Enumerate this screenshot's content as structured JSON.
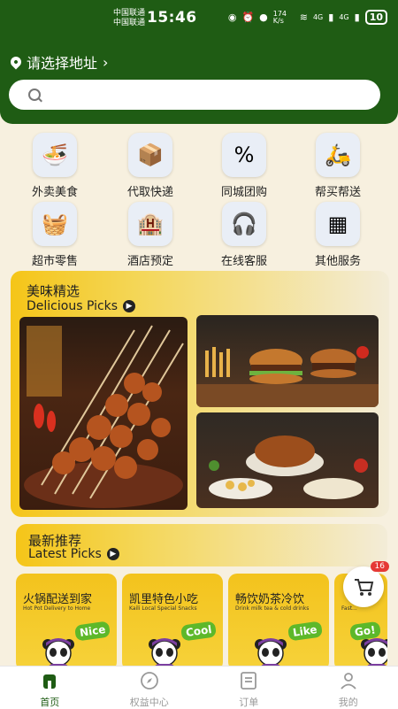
{
  "status_bar": {
    "carrier1": "中国联通",
    "carrier2": "中国联通",
    "time": "15:46",
    "net_speed": "174 K/s",
    "signal1": "4G",
    "signal2": "4G",
    "battery": "10"
  },
  "header": {
    "location_label": "请选择地址",
    "search_placeholder": ""
  },
  "services": [
    {
      "label": "外卖美食",
      "icon": "noodle-bowl-icon",
      "glyph": "🍜"
    },
    {
      "label": "代取快递",
      "icon": "package-icon",
      "glyph": "📦"
    },
    {
      "label": "同城团购",
      "icon": "discount-megaphone-icon",
      "glyph": "%"
    },
    {
      "label": "帮买帮送",
      "icon": "scooter-icon",
      "glyph": "🛵"
    },
    {
      "label": "超市零售",
      "icon": "grocery-basket-icon",
      "glyph": "🧺"
    },
    {
      "label": "酒店预定",
      "icon": "hotel-icon",
      "glyph": "🏨"
    },
    {
      "label": "在线客服",
      "icon": "customer-service-icon",
      "glyph": "🎧"
    },
    {
      "label": "其他服务",
      "icon": "grid-apps-icon",
      "glyph": "▦"
    }
  ],
  "featured": {
    "title_cn": "美味精选",
    "title_en": "Delicious Picks"
  },
  "latest": {
    "title_cn": "最新推荐",
    "title_en": "Latest Picks",
    "cards": [
      {
        "title": "火锅配送到家",
        "subtitle": "Hot Pot Delivery to Home",
        "bubble": "Nice"
      },
      {
        "title": "凯里特色小吃",
        "subtitle": "Kaili Local Special Snacks",
        "bubble": "Cool"
      },
      {
        "title": "畅饮奶茶冷饮",
        "subtitle": "Drink milk tea & cold drinks",
        "bubble": "Like"
      },
      {
        "title": "",
        "subtitle": "Fast...",
        "bubble": "Go!"
      }
    ]
  },
  "cart": {
    "count": "16"
  },
  "tabbar": [
    {
      "label": "首页",
      "icon": "home-icon"
    },
    {
      "label": "权益中心",
      "icon": "compass-icon"
    },
    {
      "label": "订单",
      "icon": "order-list-icon"
    },
    {
      "label": "我的",
      "icon": "profile-icon"
    }
  ]
}
